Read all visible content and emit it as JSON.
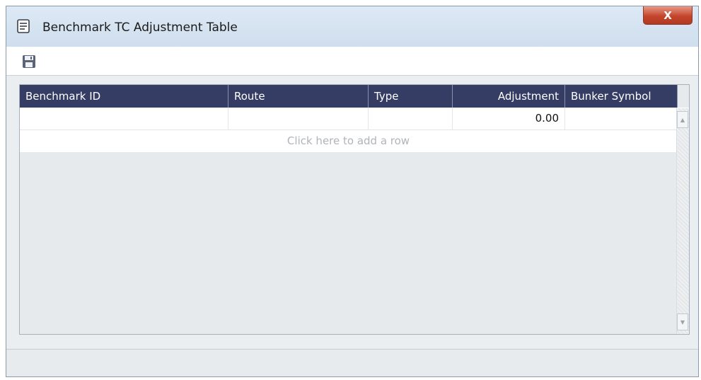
{
  "window": {
    "title": "Benchmark TC Adjustment Table",
    "title_icon": "document-icon",
    "close_label": "X"
  },
  "toolbar": {
    "save_icon": "save-icon"
  },
  "grid": {
    "columns": [
      "Benchmark ID",
      "Route",
      "Type",
      "Adjustment",
      "Bunker Symbol"
    ],
    "rows": [
      {
        "benchmark_id": "",
        "route": "",
        "type": "",
        "adjustment": "0.00",
        "bunker_symbol": ""
      }
    ],
    "add_row_text": "Click here to add a row"
  },
  "scrollbar": {
    "up_glyph": "▲",
    "down_glyph": "▼"
  }
}
